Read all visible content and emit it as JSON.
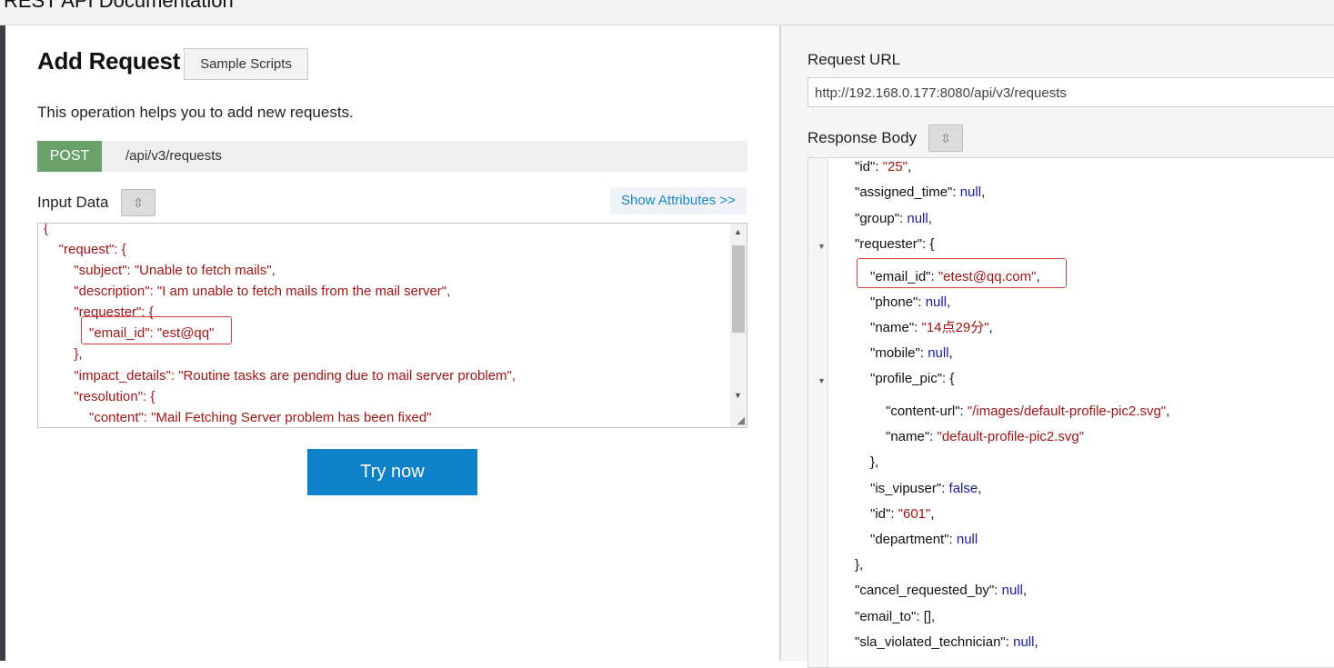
{
  "window": {
    "title": "REST API Documentation"
  },
  "left": {
    "heading": "Add Request",
    "sample_scripts_label": "Sample Scripts",
    "description": "This operation helps you to add new requests.",
    "method": "POST",
    "endpoint": "/api/v3/requests",
    "input_label": "Input Data",
    "collapse_icon": "collapse-icon",
    "show_attributes_label": "Show Attributes >>",
    "input_lines": [
      "{",
      "    \"request\": {",
      "        \"subject\": \"Unable to fetch mails\",",
      "        \"description\": \"I am unable to fetch mails from the mail server\",",
      "        \"requester\": {",
      "            \"email_id\": \"est@qq\"",
      "        },",
      "        \"impact_details\": \"Routine tasks are pending due to mail server problem\",",
      "        \"resolution\": {",
      "            \"content\": \"Mail Fetching Server problem has been fixed\""
    ],
    "try_now_label": "Try now"
  },
  "right": {
    "request_url_label": "Request URL",
    "request_url": "http://192.168.0.177:8080/api/v3/requests",
    "response_body_label": "Response Body",
    "response_lines": [
      {
        "key": "\"id\"",
        "sep": ": ",
        "val": "\"25\"",
        "type": "s",
        "trail": ","
      },
      {
        "key": "\"assigned_time\"",
        "sep": ": ",
        "val": "null",
        "type": "n",
        "trail": ","
      },
      {
        "key": "\"group\"",
        "sep": ": ",
        "val": "null",
        "type": "n",
        "trail": ","
      },
      {
        "key": "\"requester\"",
        "sep": ": ",
        "val": "{",
        "type": "p",
        "trail": ""
      },
      {
        "key": "\"email_id\"",
        "sep": ": ",
        "val": "\"etest@qq.com\"",
        "type": "s",
        "trail": ","
      },
      {
        "key": "\"phone\"",
        "sep": ": ",
        "val": "null",
        "type": "n",
        "trail": ","
      },
      {
        "key": "\"name\"",
        "sep": ": ",
        "val": "\"14点29分\"",
        "type": "s",
        "trail": ","
      },
      {
        "key": "\"mobile\"",
        "sep": ": ",
        "val": "null",
        "type": "n",
        "trail": ","
      },
      {
        "key": "\"profile_pic\"",
        "sep": ": ",
        "val": "{",
        "type": "p",
        "trail": ""
      },
      {
        "key": "\"content-url\"",
        "sep": ": ",
        "val": "\"/images/default-profile-pic2.svg\"",
        "type": "s",
        "trail": ","
      },
      {
        "key": "\"name\"",
        "sep": ": ",
        "val": "\"default-profile-pic2.svg\"",
        "type": "s",
        "trail": ""
      },
      {
        "key": "},",
        "sep": "",
        "val": "",
        "type": "p",
        "trail": ""
      },
      {
        "key": "\"is_vipuser\"",
        "sep": ": ",
        "val": "false",
        "type": "n",
        "trail": ","
      },
      {
        "key": "\"id\"",
        "sep": ": ",
        "val": "\"601\"",
        "type": "s",
        "trail": ","
      },
      {
        "key": "\"department\"",
        "sep": ": ",
        "val": "null",
        "type": "n",
        "trail": ""
      },
      {
        "key": "},",
        "sep": "",
        "val": "",
        "type": "p",
        "trail": ""
      },
      {
        "key": "\"cancel_requested_by\"",
        "sep": ": ",
        "val": "null",
        "type": "n",
        "trail": ","
      },
      {
        "key": "\"email_to\"",
        "sep": ": ",
        "val": "[]",
        "type": "p",
        "trail": ","
      },
      {
        "key": "\"sla_violated_technician\"",
        "sep": ": ",
        "val": "null",
        "type": "n",
        "trail": ","
      }
    ]
  }
}
